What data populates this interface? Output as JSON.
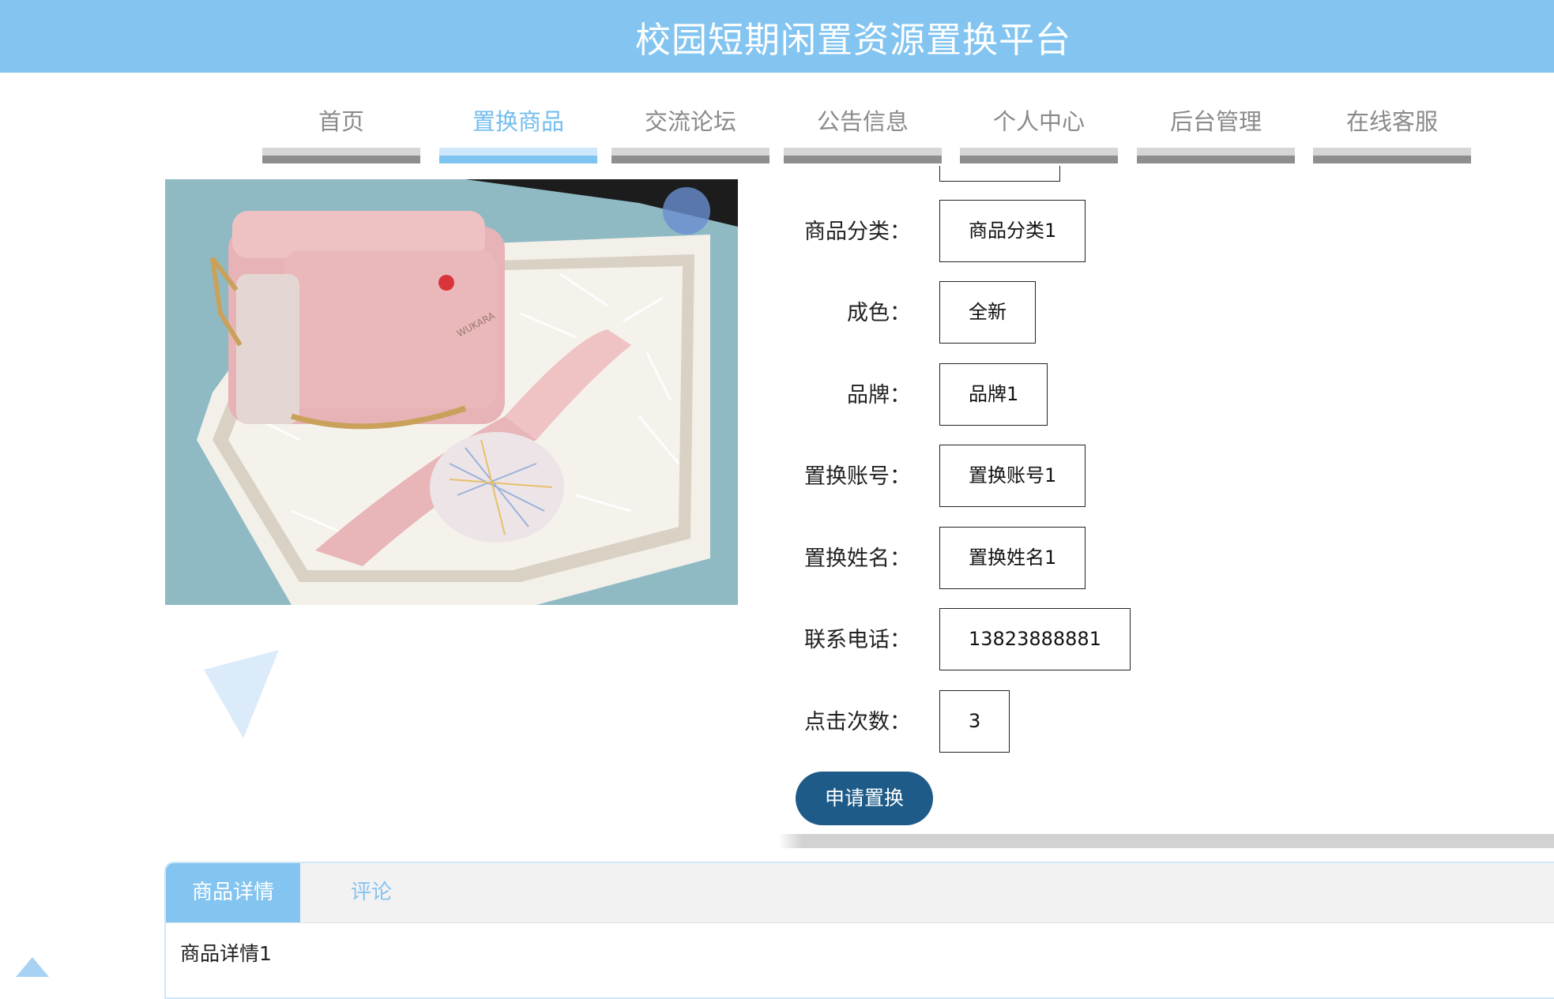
{
  "header": {
    "title": "校园短期闲置资源置换平台"
  },
  "nav": {
    "items": [
      {
        "label": "首页",
        "active": false
      },
      {
        "label": "置换商品",
        "active": true
      },
      {
        "label": "交流论坛",
        "active": false
      },
      {
        "label": "公告信息",
        "active": false
      },
      {
        "label": "个人中心",
        "active": false
      },
      {
        "label": "后台管理",
        "active": false
      },
      {
        "label": "在线客服",
        "active": false
      }
    ]
  },
  "details": {
    "fields": [
      {
        "label": "商品分类：",
        "value": "商品分类1"
      },
      {
        "label": "成色：",
        "value": "全新"
      },
      {
        "label": "品牌：",
        "value": "品牌1"
      },
      {
        "label": "置换账号：",
        "value": "置换账号1"
      },
      {
        "label": "置换姓名：",
        "value": "置换姓名1"
      },
      {
        "label": "联系电话：",
        "value": "13823888881"
      },
      {
        "label": "点击次数：",
        "value": "3"
      }
    ],
    "apply_label": "申请置换"
  },
  "photo": {
    "brand_text": "WUKARA"
  },
  "tabs": {
    "items": [
      {
        "label": "商品详情",
        "active": true
      },
      {
        "label": "评论",
        "active": false
      }
    ],
    "content": "商品详情1"
  },
  "colors": {
    "header_bg": "#83c5f0",
    "accent": "#74bdee",
    "button_bg": "#1e5b88"
  }
}
